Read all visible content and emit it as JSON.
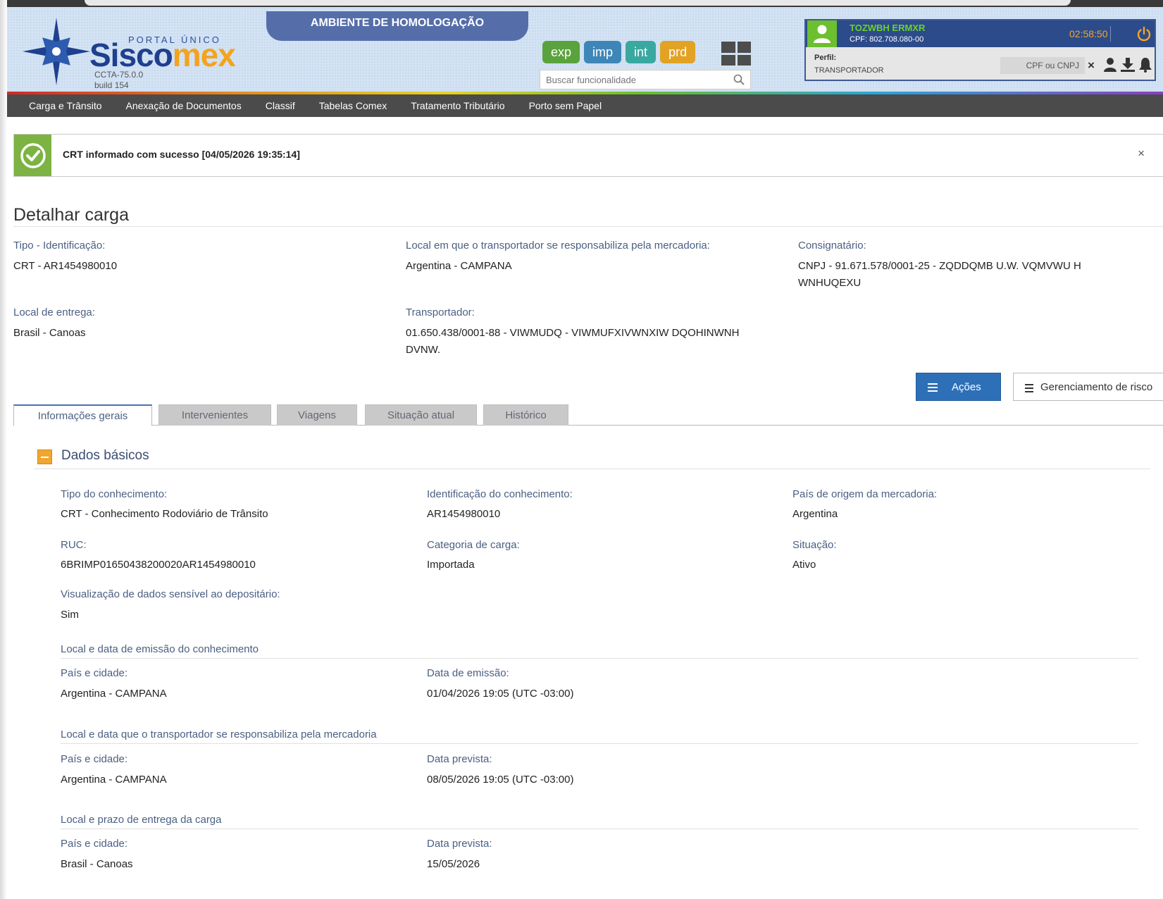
{
  "header": {
    "portal_label": "PORTAL ÚNICO",
    "logo_text_1": "Sisco",
    "logo_text_2": "mex",
    "version": "CCTA-75.0.0",
    "build": "build 154",
    "environment_banner": "AMBIENTE DE HOMOLOGAÇÃO",
    "modes": [
      {
        "label": "exp",
        "color": "#5aa33c"
      },
      {
        "label": "imp",
        "color": "#3f86b8"
      },
      {
        "label": "int",
        "color": "#39a8a0"
      },
      {
        "label": "prd",
        "color": "#e2a224"
      }
    ],
    "search_placeholder": "Buscar funcionalidade"
  },
  "user": {
    "name": "TOZWBH ERMXR",
    "cpf": "CPF: 802.708.080-00",
    "session_timer": "02:58:50",
    "perfil_label": "Perfil:",
    "perfil_value": "TRANSPORTADOR",
    "cnpj_placeholder": "CPF ou CNPJ"
  },
  "nav": {
    "items": [
      "Carga e Trânsito",
      "Anexação de Documentos",
      "Classif",
      "Tabelas Comex",
      "Tratamento Tributário",
      "Porto sem Papel"
    ]
  },
  "alert": {
    "message": "CRT informado com sucesso [04/05/2026 19:35:14]",
    "close_glyph": "×"
  },
  "page": {
    "title": "Detalhar carga",
    "summary": {
      "tipo_label": "Tipo - Identificação:",
      "tipo_value": "CRT - AR1454980010",
      "local_resp_label": "Local em que o transportador se responsabiliza pela mercadoria:",
      "local_resp_value": "Argentina - CAMPANA",
      "consignatario_label": "Consignatário:",
      "consignatario_value_1": "CNPJ - 91.671.578/0001-25 - ZQDDQMB U.W. VQMVWU H",
      "consignatario_value_2": "WNHUQEXU",
      "local_entrega_label": "Local de entrega:",
      "local_entrega_value": "Brasil - Canoas",
      "transportador_label": "Transportador:",
      "transportador_value_1": "01.650.438/0001-88 - VIWMUDQ - VIWMUFXIVWNXIW DQOHINWNH",
      "transportador_value_2": "DVNW."
    },
    "actions": {
      "acoes": "Ações",
      "risco": "Gerenciamento de risco"
    },
    "tabs": [
      "Informações gerais",
      "Intervenientes",
      "Viagens",
      "Situação atual",
      "Histórico"
    ]
  },
  "dados_basicos": {
    "title": "Dados básicos",
    "tipo_conhecimento_label": "Tipo do conhecimento:",
    "tipo_conhecimento_value": "CRT - Conhecimento Rodoviário de Trânsito",
    "identificacao_label": "Identificação do conhecimento:",
    "identificacao_value": "AR1454980010",
    "pais_origem_label": "País de origem da mercadoria:",
    "pais_origem_value": "Argentina",
    "ruc_label": "RUC:",
    "ruc_value": "6BRIMP01650438200020AR1454980010",
    "categoria_label": "Categoria de carga:",
    "categoria_value": "Importada",
    "situacao_label": "Situação:",
    "situacao_value": "Ativo",
    "visualizacao_label": "Visualização de dados sensível ao depositário:",
    "visualizacao_value": "Sim",
    "emissao_title": "Local e data de emissão do conhecimento",
    "emissao_pais_label": "País e cidade:",
    "emissao_pais_value": "Argentina - CAMPANA",
    "emissao_data_label": "Data de emissão:",
    "emissao_data_value": "01/04/2026 19:05 (UTC -03:00)",
    "resp_title": "Local e data que o transportador se responsabiliza pela mercadoria",
    "resp_pais_label": "País e cidade:",
    "resp_pais_value": "Argentina - CAMPANA",
    "resp_data_label": "Data prevista:",
    "resp_data_value": "08/05/2026 19:05 (UTC -03:00)",
    "entrega_title": "Local e prazo de entrega da carga",
    "entrega_pais_label": "País e cidade:",
    "entrega_pais_value": "Brasil - Canoas",
    "entrega_data_label": "Data prevista:",
    "entrega_data_value": "15/05/2026"
  }
}
